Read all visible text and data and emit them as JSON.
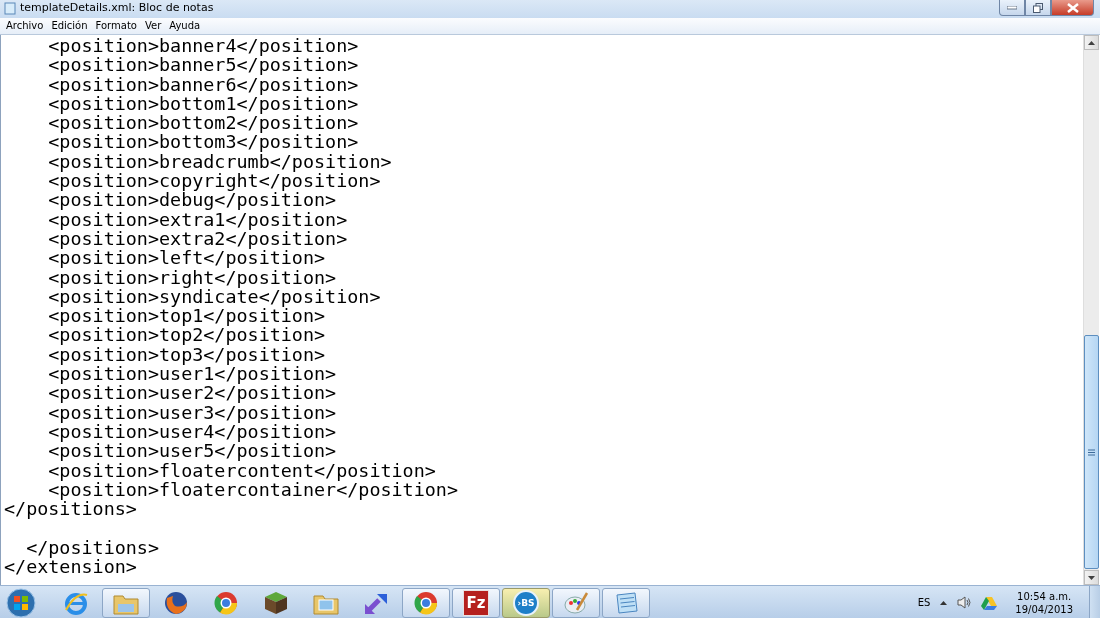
{
  "window": {
    "title": "templateDetails.xml: Bloc de notas"
  },
  "menu": [
    "Archivo",
    "Edición",
    "Formato",
    "Ver",
    "Ayuda"
  ],
  "editor": {
    "lines": [
      {
        "kind": "text",
        "text": "    <position>banner4</position>"
      },
      {
        "kind": "text",
        "text": "    <position>banner5</position>"
      },
      {
        "kind": "text",
        "text": "    <position>banner6</position>"
      },
      {
        "kind": "text",
        "text": "    <position>bottom1</position>"
      },
      {
        "kind": "text",
        "text": "    <position>bottom2</position>"
      },
      {
        "kind": "text",
        "text": "    <position>bottom3</position>"
      },
      {
        "kind": "text",
        "text": "    <position>breadcrumb</position>"
      },
      {
        "kind": "text",
        "text": "    <position>copyright</position>"
      },
      {
        "kind": "text",
        "text": "    <position>debug</position>"
      },
      {
        "kind": "text",
        "text": "    <position>extra1</position>"
      },
      {
        "kind": "text",
        "text": "    <position>extra2</position>"
      },
      {
        "kind": "text",
        "text": "    <position>left</position>"
      },
      {
        "kind": "text",
        "text": "    <position>right</position>"
      },
      {
        "kind": "text",
        "text": "    <position>syndicate</position>"
      },
      {
        "kind": "text",
        "text": "    <position>top1</position>"
      },
      {
        "kind": "text",
        "text": "    <position>top2</position>"
      },
      {
        "kind": "text",
        "text": "    <position>top3</position>"
      },
      {
        "kind": "text",
        "text": "    <position>user1</position>"
      },
      {
        "kind": "text",
        "text": "    <position>user2</position>"
      },
      {
        "kind": "text",
        "text": "    <position>user3</position>"
      },
      {
        "kind": "text",
        "text": "    <position>user4</position>"
      },
      {
        "kind": "text",
        "text": "    <position>user5</position>"
      },
      {
        "kind": "text",
        "text": "    <position>floatercontent</position>"
      },
      {
        "kind": "text",
        "text": "    <position>floatercontainer</position>"
      },
      {
        "kind": "text",
        "text": "</positions>"
      },
      {
        "kind": "blank"
      },
      {
        "kind": "text",
        "text": "  </positions>"
      },
      {
        "kind": "text",
        "text": "</extension>"
      }
    ]
  },
  "taskbar": {
    "items": [
      {
        "kind": "browser-e",
        "open": false,
        "highlighted": false
      },
      {
        "kind": "folder",
        "open": true,
        "highlighted": false
      },
      {
        "kind": "fox-globe",
        "open": false,
        "highlighted": false
      },
      {
        "kind": "ring-globe",
        "open": false,
        "highlighted": false
      },
      {
        "kind": "cube",
        "open": false,
        "highlighted": false
      },
      {
        "kind": "photo-folder",
        "open": false,
        "highlighted": false
      },
      {
        "kind": "arrows",
        "open": false,
        "highlighted": false
      },
      {
        "kind": "ring-globe",
        "open": true,
        "highlighted": false
      },
      {
        "kind": "letter-tile",
        "label": "Fz",
        "open": true,
        "highlighted": false
      },
      {
        "kind": "letter-disc",
        "label": "›BS",
        "open": true,
        "highlighted": true
      },
      {
        "kind": "palette",
        "open": true,
        "highlighted": false
      },
      {
        "kind": "notepad",
        "open": true,
        "highlighted": false
      }
    ],
    "tray": {
      "language": "ES",
      "time": "10:54 a.m.",
      "date": "19/04/2013"
    }
  }
}
